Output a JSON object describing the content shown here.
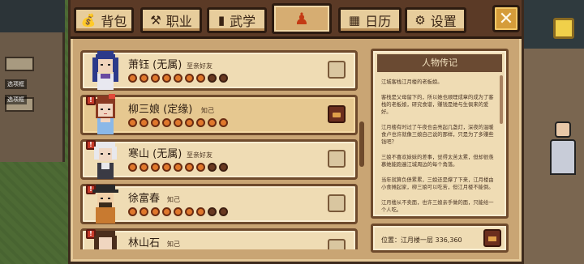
{
  "tabs": [
    {
      "label": "背包",
      "icon": "bag-icon"
    },
    {
      "label": "职业",
      "icon": "hammer-icon"
    },
    {
      "label": "武学",
      "icon": "book-icon"
    },
    {
      "label": "",
      "icon": "person-icon"
    },
    {
      "label": "日历",
      "icon": "calendar-icon"
    },
    {
      "label": "设置",
      "icon": "gear-icon"
    }
  ],
  "close_label": "✕",
  "characters": [
    {
      "name": "萧钰 (无属)",
      "relation": "至亲好友",
      "hearts_filled": 7,
      "hearts_total": 9,
      "has_item": false,
      "marked": false,
      "selected": false
    },
    {
      "name": "柳三娘 (定缘)",
      "relation": "知己",
      "hearts_filled": 9,
      "hearts_total": 9,
      "has_item": true,
      "marked": true,
      "selected": true
    },
    {
      "name": "寒山 (无属)",
      "relation": "至亲好友",
      "hearts_filled": 7,
      "hearts_total": 9,
      "has_item": false,
      "marked": true,
      "selected": false
    },
    {
      "name": "徐富春",
      "relation": "知己",
      "hearts_filled": 7,
      "hearts_total": 9,
      "has_item": false,
      "marked": true,
      "selected": false
    },
    {
      "name": "林山石",
      "relation": "知己",
      "hearts_filled": 0,
      "hearts_total": 9,
      "has_item": false,
      "marked": true,
      "selected": false
    }
  ],
  "bio": {
    "title": "人物传记",
    "paragraphs": [
      "江城客栈江月楼的老板娘。",
      "客栈是父母留下的，所以她也顺理成章的成为了客栈的老板娘，研究食谱，赚钱是她与生俱来的爱好。",
      "江月楼有时过了午夜也会亮起几盏灯，深夜的温暖食卢也许就像三娘自己说的那样，只是为了多赚些钱吧？",
      "三娘不喜欢妹妹的差事，觉得太苦太累，但却很羡慕她能跑遍江城周边的每个角落。",
      "当年就算负债累累，三娘还是撑了下来，江月楼由小食摊起家，柳三娘可以吃苦，但江月楼不能倒。",
      "江月楼从不卖面，也许三娘亲手做的面，只能给一个人吃。"
    ]
  },
  "location": {
    "text": "位置：江月楼一层 336,360"
  },
  "scene_tags": [
    "选项框",
    "选项框"
  ]
}
